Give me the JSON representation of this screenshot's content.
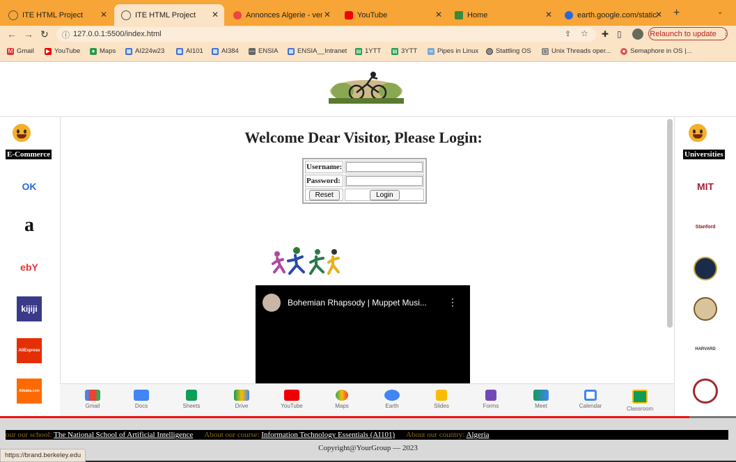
{
  "tabs": [
    {
      "label": "ITE HTML Project",
      "icon": "globe-icon",
      "active": false
    },
    {
      "label": "ITE HTML Project",
      "icon": "globe-icon",
      "active": true
    },
    {
      "label": "Annonces Algerie - vente",
      "icon": "chrome-icon",
      "active": false
    },
    {
      "label": "YouTube",
      "icon": "youtube-icon",
      "active": false
    },
    {
      "label": "Home",
      "icon": "home-icon",
      "active": false
    },
    {
      "label": "earth.google.com/static/m",
      "icon": "earth-icon",
      "active": false
    }
  ],
  "toolbar": {
    "url": "127.0.0.1:5500/index.html",
    "relaunch_label": "Relaunch to update"
  },
  "bookmarks": [
    "Gmail",
    "YouTube",
    "Maps",
    "AI224w23",
    "AI101",
    "AI384",
    "ENSIA",
    "ENSIA__Intranet",
    "1YTT",
    "3YTT",
    "Pipes in Linux",
    "Stattling OS",
    "Unix Threads oper...",
    "Semaphore in OS |..."
  ],
  "left_column": {
    "label": "E-Commerce",
    "logos": [
      "OK",
      "a",
      "ebY",
      "kijiji",
      "AliExpress",
      "Alibaba.com"
    ]
  },
  "right_column": {
    "label": "Universities",
    "logos": [
      "MIT",
      "Stanford",
      "Oxford",
      "Cambridge",
      "HARVARD",
      "Berkeley"
    ]
  },
  "main": {
    "welcome": "Welcome Dear Visitor, Please Login:",
    "username_label": "Username:",
    "password_label": "Password:",
    "reset_label": "Reset",
    "login_label": "Login"
  },
  "video": {
    "title": "Bohemian Rhapsody | Muppet Musi..."
  },
  "apps": [
    "Gmail",
    "Docs",
    "Sheets",
    "Drive",
    "YouTube",
    "Maps",
    "Earth",
    "Slides",
    "Forms",
    "Meet",
    "Calendar",
    "Classroom"
  ],
  "footer": {
    "school_prefix": "our our school:",
    "school_link": "The National School of Artificial Intelligence",
    "course_prefix": "About our course:",
    "course_link": "Information Technology Essentials (AI101)",
    "country_prefix": "About our country:",
    "country_link": "Algeria",
    "copyright": "Copyright@YourGroup — 2023"
  },
  "status_bar_url": "https://brand.berkeley.edu"
}
